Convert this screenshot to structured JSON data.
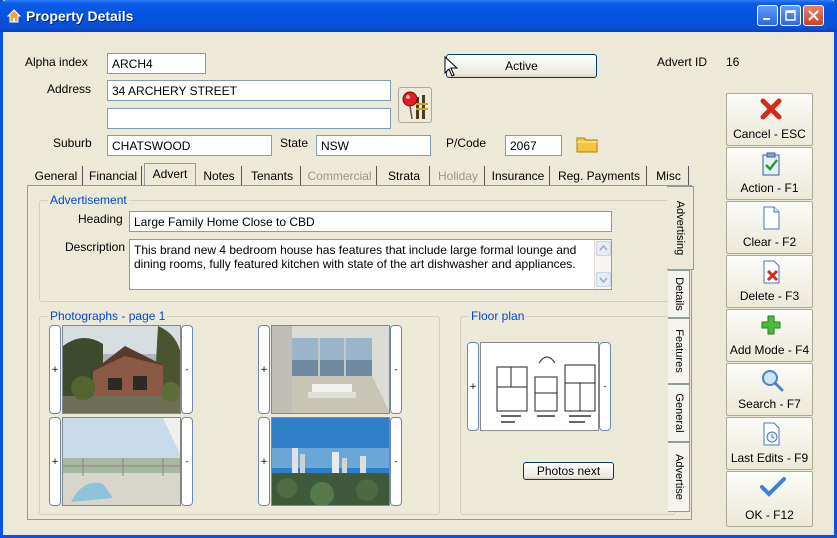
{
  "window": {
    "title": "Property Details"
  },
  "header": {
    "alpha_label": "Alpha index",
    "alpha_value": "ARCH4",
    "address_label": "Address",
    "address_line1": "34 ARCHERY STREET",
    "address_line2": "",
    "suburb_label": "Suburb",
    "suburb_value": "CHATSWOOD",
    "state_label": "State",
    "state_value": "NSW",
    "pcode_label": "P/Code",
    "pcode_value": "2067",
    "status_button": "Active",
    "advert_id_label": "Advert ID",
    "advert_id_value": "16"
  },
  "tabs": [
    {
      "label": "General",
      "state": "normal"
    },
    {
      "label": "Financial",
      "state": "normal"
    },
    {
      "label": "Advert",
      "state": "active"
    },
    {
      "label": "Notes",
      "state": "normal"
    },
    {
      "label": "Tenants",
      "state": "normal"
    },
    {
      "label": "Commercial",
      "state": "disabled"
    },
    {
      "label": "Strata",
      "state": "normal"
    },
    {
      "label": "Holiday",
      "state": "disabled"
    },
    {
      "label": "Insurance",
      "state": "normal"
    },
    {
      "label": "Reg. Payments",
      "state": "normal"
    },
    {
      "label": "Misc",
      "state": "normal"
    }
  ],
  "vertical_tabs": [
    "Advertising",
    "Details",
    "Features",
    "General",
    "Advertise"
  ],
  "advertisement": {
    "group_title": "Advertisement",
    "heading_label": "Heading",
    "heading_value": "Large Family Home Close to CBD",
    "description_label": "Description",
    "description_value": "This brand new 4 bedroom house has features that include large formal lounge and dining rooms, fully featured kitchen with state of the art dishwasher and appliances."
  },
  "photos": {
    "group_title": "Photographs - page 1",
    "add_symbol": "+",
    "remove_symbol": "-"
  },
  "floorplan": {
    "group_title": "Floor plan",
    "next_button": "Photos next"
  },
  "sidebar": {
    "cancel": "Cancel - ESC",
    "action": "Action - F1",
    "clear": "Clear - F2",
    "delete": "Delete - F3",
    "add_mode": "Add Mode - F4",
    "search": "Search - F7",
    "last_edits": "Last Edits - F9",
    "ok": "OK - F12"
  },
  "colors": {
    "title_bar": "#0a53e0",
    "group_title": "#0046d5",
    "window_bg": "#ece9d8"
  }
}
